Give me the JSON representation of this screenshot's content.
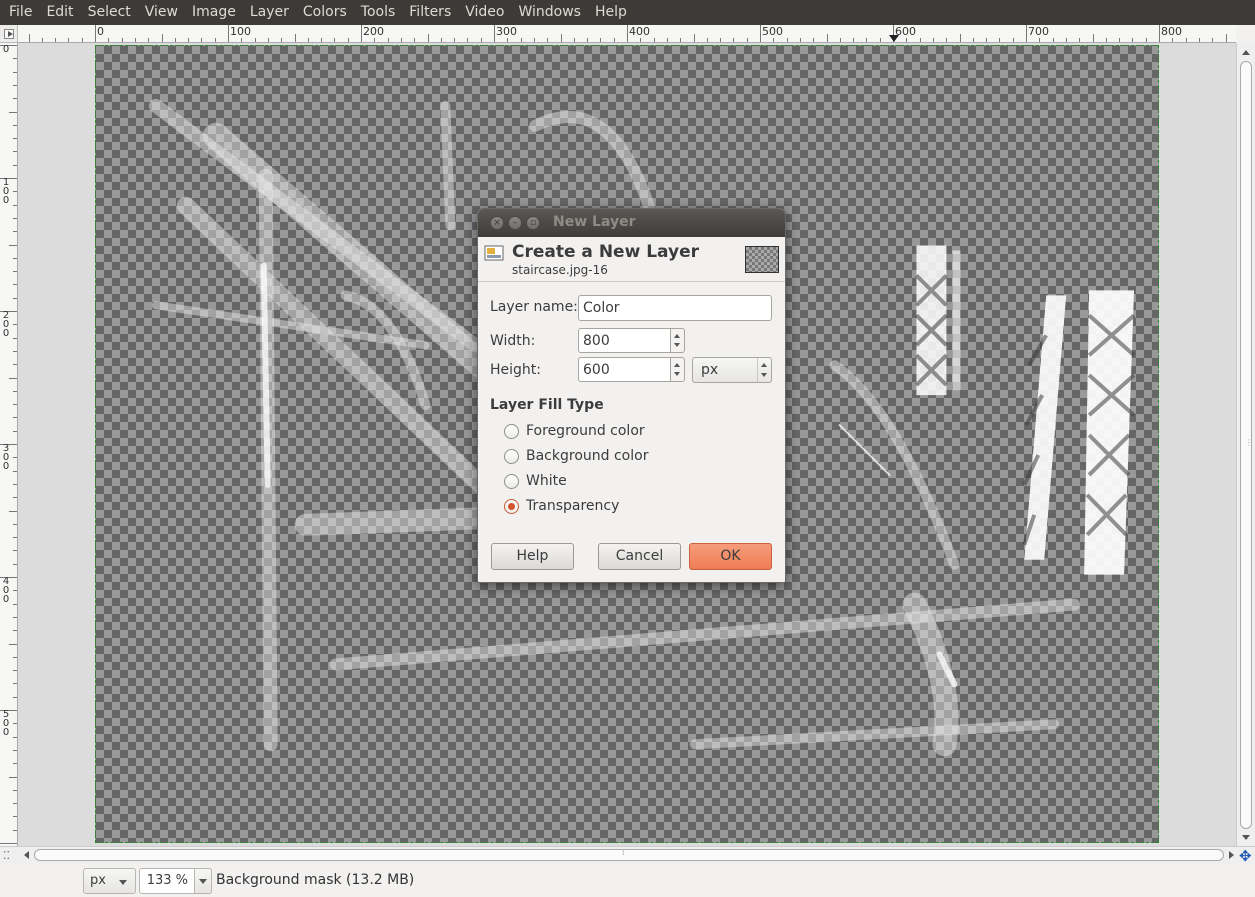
{
  "menubar": {
    "items": [
      "File",
      "Edit",
      "Select",
      "View",
      "Image",
      "Layer",
      "Colors",
      "Tools",
      "Filters",
      "Video",
      "Windows",
      "Help"
    ]
  },
  "rulers": {
    "horizontal_labels": [
      "0",
      "100",
      "200",
      "300",
      "400",
      "500",
      "600",
      "700",
      "800"
    ],
    "vertical_labels": [
      "0",
      "100",
      "200",
      "300",
      "400",
      "500"
    ]
  },
  "dialog": {
    "window_title": "New Layer",
    "heading": "Create a New Layer",
    "subheading": "staircase.jpg-16",
    "layer_name_label": "Layer name:",
    "layer_name_value": "Color",
    "width_label": "Width:",
    "width_value": "800",
    "height_label": "Height:",
    "height_value": "600",
    "size_unit": "px",
    "fill_type_title": "Layer Fill Type",
    "fill_options": [
      "Foreground color",
      "Background color",
      "White",
      "Transparency"
    ],
    "selected_fill": "Transparency",
    "help_button": "Help",
    "cancel_button": "Cancel",
    "ok_button": "OK"
  },
  "statusbar": {
    "unit": "px",
    "zoom": "133 %",
    "message": "Background mask (13.2 MB)"
  },
  "colors": {
    "menubar_bg": "#3c3b37",
    "accent_orange": "#ef7d54",
    "selection_border": "#2a8a2a"
  }
}
